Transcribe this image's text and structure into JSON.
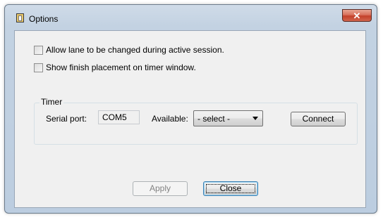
{
  "window": {
    "title": "Options",
    "close_symbol": "✕",
    "icon": "clipboard-icon"
  },
  "options": {
    "allow_lane_change": {
      "label": "Allow lane to be changed during active session.",
      "checked": false
    },
    "show_finish_placement": {
      "label": "Show finish placement on timer window.",
      "checked": false
    }
  },
  "timer": {
    "group_label": "Timer",
    "serial_port_label": "Serial port:",
    "serial_port_value": "COM5",
    "available_label": "Available:",
    "available_selected": "- select -",
    "connect_label": "Connect"
  },
  "buttons": {
    "apply_label": "Apply",
    "apply_enabled": false,
    "close_label": "Close"
  },
  "colors": {
    "frame": "#bccde0",
    "client": "#f0f0f0",
    "close_button": "#c3402a",
    "default_button_border": "#3c7fb1"
  }
}
